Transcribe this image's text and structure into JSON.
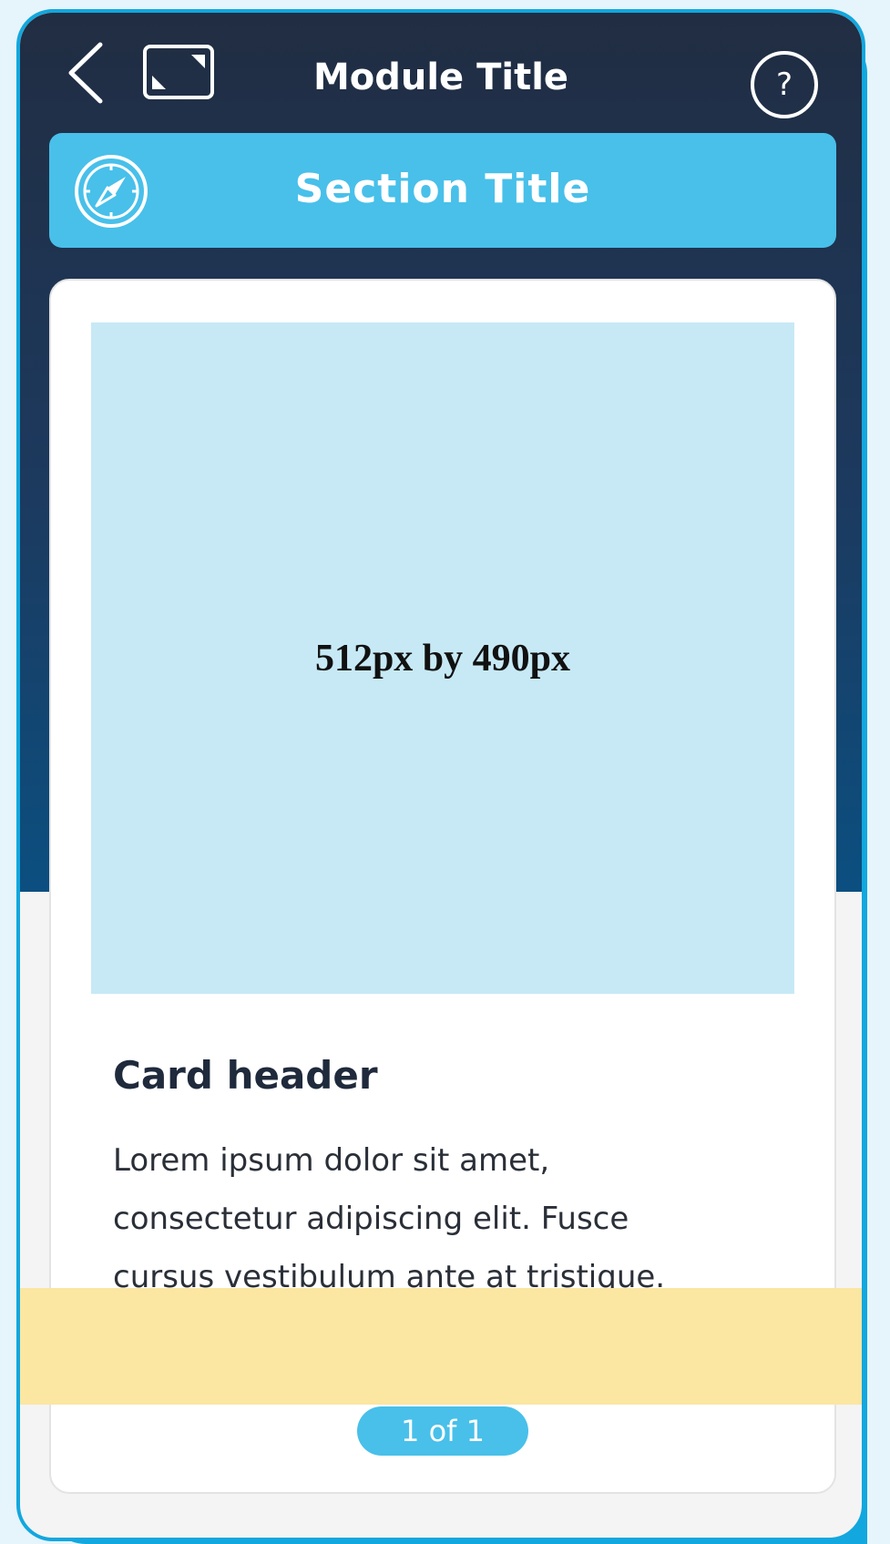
{
  "header": {
    "module_title": "Module Title",
    "help_label": "?"
  },
  "section": {
    "title": "Section Title"
  },
  "card": {
    "image_placeholder_text": "512px by 490px",
    "header": "Card header",
    "body": "Lorem ipsum dolor sit amet, consectetur adipiscing elit. Fusce cursus vestibulum ante at tristique."
  },
  "pagination": {
    "label": "1 of 1"
  },
  "colors": {
    "accent": "#48c0ea",
    "frame": "#12a7de",
    "header_dark": "#212d42",
    "image_bg": "#c7e9f5",
    "highlight": "#fbe6a2"
  },
  "icons": [
    "back-chevron-icon",
    "fullscreen-icon",
    "help-icon",
    "compass-icon"
  ]
}
